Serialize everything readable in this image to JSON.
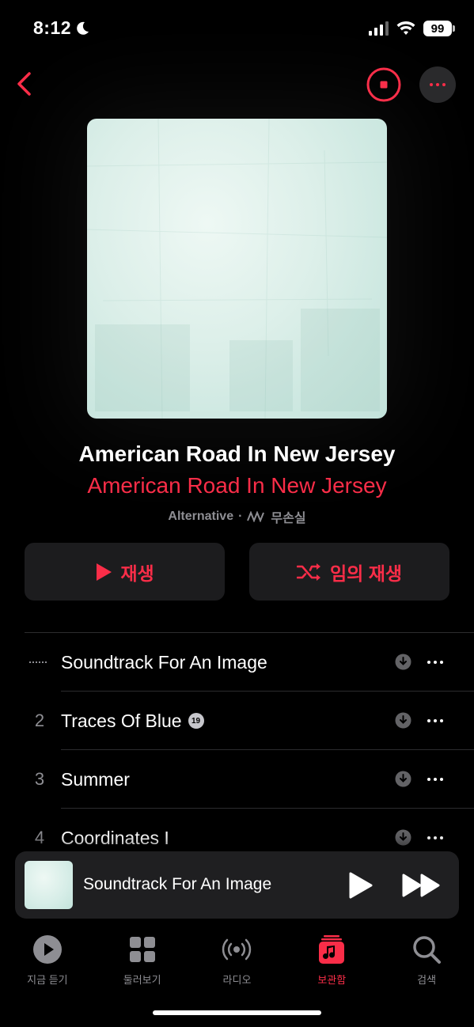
{
  "status": {
    "time": "8:12",
    "battery": "99"
  },
  "album": {
    "title": "American Road In New Jersey",
    "artist": "American Road In New Jersey",
    "genre": "Alternative",
    "separator": "·",
    "quality": "무손실"
  },
  "actions": {
    "play_label": "재생",
    "shuffle_label": "임의 재생"
  },
  "tracks": [
    {
      "number": "",
      "title": "Soundtrack For An Image",
      "badge": ""
    },
    {
      "number": "2",
      "title": "Traces Of Blue",
      "badge": "19"
    },
    {
      "number": "3",
      "title": "Summer",
      "badge": ""
    },
    {
      "number": "4",
      "title": "Coordinates I",
      "badge": ""
    }
  ],
  "mini_player": {
    "title": "Soundtrack For An Image"
  },
  "tabs": [
    {
      "label": "지금 듣기",
      "icon": "play-circle-icon"
    },
    {
      "label": "둘러보기",
      "icon": "grid-icon"
    },
    {
      "label": "라디오",
      "icon": "radio-icon"
    },
    {
      "label": "보관함",
      "icon": "library-icon"
    },
    {
      "label": "검색",
      "icon": "search-icon"
    }
  ],
  "colors": {
    "accent": "#fa2d48",
    "background": "#000000",
    "surface": "#1c1c1e",
    "secondary_text": "#8e8e93"
  }
}
